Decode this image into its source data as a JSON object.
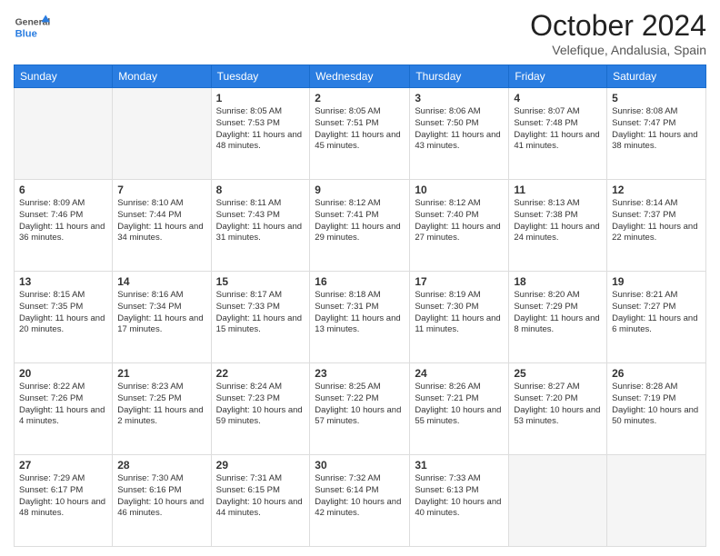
{
  "logo": {
    "general": "General",
    "blue": "Blue"
  },
  "title": "October 2024",
  "location": "Velefique, Andalusia, Spain",
  "days_of_week": [
    "Sunday",
    "Monday",
    "Tuesday",
    "Wednesday",
    "Thursday",
    "Friday",
    "Saturday"
  ],
  "weeks": [
    [
      {
        "day": "",
        "info": ""
      },
      {
        "day": "",
        "info": ""
      },
      {
        "day": "1",
        "info": "Sunrise: 8:05 AM\nSunset: 7:53 PM\nDaylight: 11 hours and 48 minutes."
      },
      {
        "day": "2",
        "info": "Sunrise: 8:05 AM\nSunset: 7:51 PM\nDaylight: 11 hours and 45 minutes."
      },
      {
        "day": "3",
        "info": "Sunrise: 8:06 AM\nSunset: 7:50 PM\nDaylight: 11 hours and 43 minutes."
      },
      {
        "day": "4",
        "info": "Sunrise: 8:07 AM\nSunset: 7:48 PM\nDaylight: 11 hours and 41 minutes."
      },
      {
        "day": "5",
        "info": "Sunrise: 8:08 AM\nSunset: 7:47 PM\nDaylight: 11 hours and 38 minutes."
      }
    ],
    [
      {
        "day": "6",
        "info": "Sunrise: 8:09 AM\nSunset: 7:46 PM\nDaylight: 11 hours and 36 minutes."
      },
      {
        "day": "7",
        "info": "Sunrise: 8:10 AM\nSunset: 7:44 PM\nDaylight: 11 hours and 34 minutes."
      },
      {
        "day": "8",
        "info": "Sunrise: 8:11 AM\nSunset: 7:43 PM\nDaylight: 11 hours and 31 minutes."
      },
      {
        "day": "9",
        "info": "Sunrise: 8:12 AM\nSunset: 7:41 PM\nDaylight: 11 hours and 29 minutes."
      },
      {
        "day": "10",
        "info": "Sunrise: 8:12 AM\nSunset: 7:40 PM\nDaylight: 11 hours and 27 minutes."
      },
      {
        "day": "11",
        "info": "Sunrise: 8:13 AM\nSunset: 7:38 PM\nDaylight: 11 hours and 24 minutes."
      },
      {
        "day": "12",
        "info": "Sunrise: 8:14 AM\nSunset: 7:37 PM\nDaylight: 11 hours and 22 minutes."
      }
    ],
    [
      {
        "day": "13",
        "info": "Sunrise: 8:15 AM\nSunset: 7:35 PM\nDaylight: 11 hours and 20 minutes."
      },
      {
        "day": "14",
        "info": "Sunrise: 8:16 AM\nSunset: 7:34 PM\nDaylight: 11 hours and 17 minutes."
      },
      {
        "day": "15",
        "info": "Sunrise: 8:17 AM\nSunset: 7:33 PM\nDaylight: 11 hours and 15 minutes."
      },
      {
        "day": "16",
        "info": "Sunrise: 8:18 AM\nSunset: 7:31 PM\nDaylight: 11 hours and 13 minutes."
      },
      {
        "day": "17",
        "info": "Sunrise: 8:19 AM\nSunset: 7:30 PM\nDaylight: 11 hours and 11 minutes."
      },
      {
        "day": "18",
        "info": "Sunrise: 8:20 AM\nSunset: 7:29 PM\nDaylight: 11 hours and 8 minutes."
      },
      {
        "day": "19",
        "info": "Sunrise: 8:21 AM\nSunset: 7:27 PM\nDaylight: 11 hours and 6 minutes."
      }
    ],
    [
      {
        "day": "20",
        "info": "Sunrise: 8:22 AM\nSunset: 7:26 PM\nDaylight: 11 hours and 4 minutes."
      },
      {
        "day": "21",
        "info": "Sunrise: 8:23 AM\nSunset: 7:25 PM\nDaylight: 11 hours and 2 minutes."
      },
      {
        "day": "22",
        "info": "Sunrise: 8:24 AM\nSunset: 7:23 PM\nDaylight: 10 hours and 59 minutes."
      },
      {
        "day": "23",
        "info": "Sunrise: 8:25 AM\nSunset: 7:22 PM\nDaylight: 10 hours and 57 minutes."
      },
      {
        "day": "24",
        "info": "Sunrise: 8:26 AM\nSunset: 7:21 PM\nDaylight: 10 hours and 55 minutes."
      },
      {
        "day": "25",
        "info": "Sunrise: 8:27 AM\nSunset: 7:20 PM\nDaylight: 10 hours and 53 minutes."
      },
      {
        "day": "26",
        "info": "Sunrise: 8:28 AM\nSunset: 7:19 PM\nDaylight: 10 hours and 50 minutes."
      }
    ],
    [
      {
        "day": "27",
        "info": "Sunrise: 7:29 AM\nSunset: 6:17 PM\nDaylight: 10 hours and 48 minutes."
      },
      {
        "day": "28",
        "info": "Sunrise: 7:30 AM\nSunset: 6:16 PM\nDaylight: 10 hours and 46 minutes."
      },
      {
        "day": "29",
        "info": "Sunrise: 7:31 AM\nSunset: 6:15 PM\nDaylight: 10 hours and 44 minutes."
      },
      {
        "day": "30",
        "info": "Sunrise: 7:32 AM\nSunset: 6:14 PM\nDaylight: 10 hours and 42 minutes."
      },
      {
        "day": "31",
        "info": "Sunrise: 7:33 AM\nSunset: 6:13 PM\nDaylight: 10 hours and 40 minutes."
      },
      {
        "day": "",
        "info": ""
      },
      {
        "day": "",
        "info": ""
      }
    ]
  ]
}
